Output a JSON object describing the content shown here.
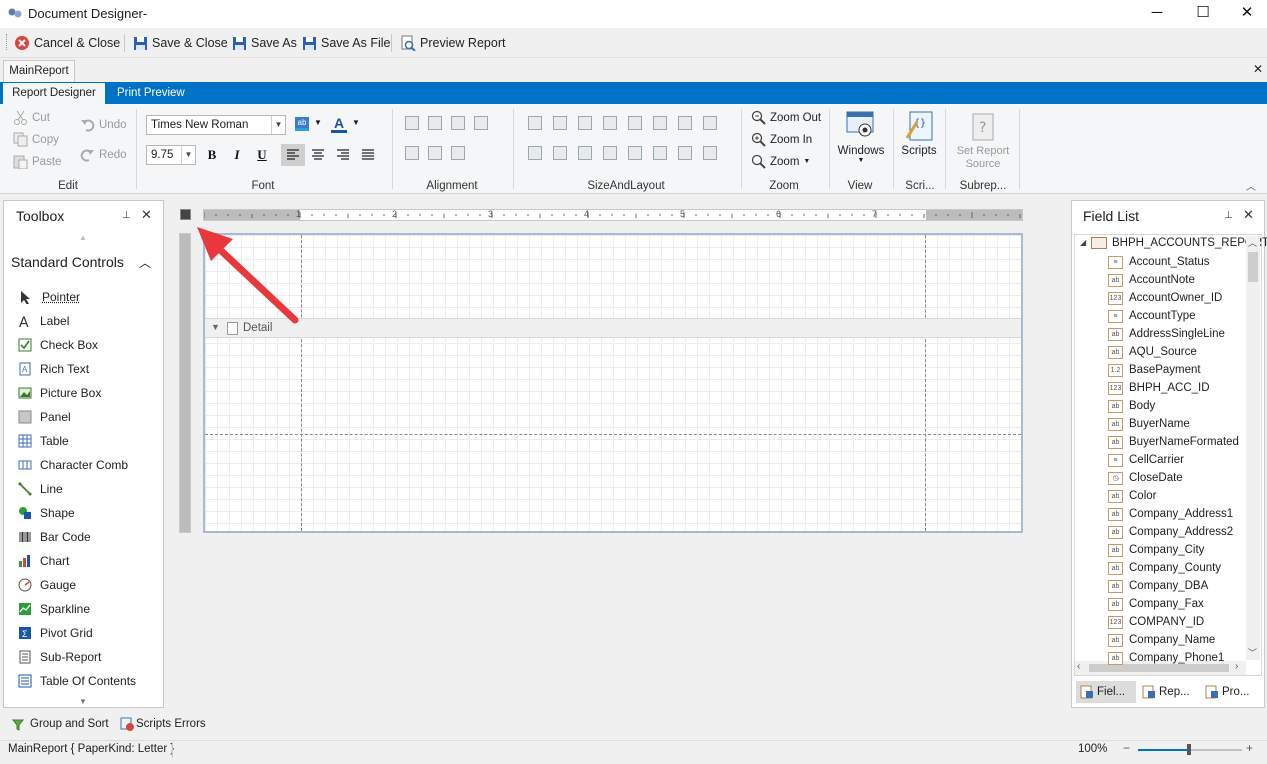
{
  "window": {
    "title": "Document Designer-",
    "minimize": "─",
    "maximize": "☐",
    "close": "✕"
  },
  "toolbar": {
    "cancel_close": "Cancel & Close",
    "save_close": "Save & Close",
    "save_as": "Save As",
    "save_as_file": "Save As File",
    "preview_report": "Preview Report"
  },
  "doc_tab": "MainReport",
  "doc_tab_close": "✕",
  "ribbon_tabs": {
    "designer": "Report Designer",
    "preview": "Print Preview"
  },
  "ribbon": {
    "edit": {
      "cut": "Cut",
      "copy": "Copy",
      "paste": "Paste",
      "undo": "Undo",
      "redo": "Redo",
      "label": "Edit"
    },
    "font": {
      "family": "Times New Roman",
      "size": "9.75",
      "label": "Font",
      "bold": "B",
      "italic": "I",
      "underline": "U"
    },
    "alignment": {
      "label": "Alignment"
    },
    "size_layout": {
      "label": "SizeAndLayout"
    },
    "zoom": {
      "zoom_out": "Zoom Out",
      "zoom_in": "Zoom In",
      "zoom": "Zoom",
      "label": "Zoom"
    },
    "view": {
      "windows": "Windows",
      "label": "View"
    },
    "scripts": {
      "scripts": "Scripts",
      "label": "Scri..."
    },
    "subreport": {
      "set_source_line1": "Set Report",
      "set_source_line2": "Source",
      "label": "Subrep..."
    }
  },
  "toolbox": {
    "title": "Toolbox",
    "section": "Standard Controls",
    "items": [
      "Pointer",
      "Label",
      "Check Box",
      "Rich Text",
      "Picture Box",
      "Panel",
      "Table",
      "Character Comb",
      "Line",
      "Shape",
      "Bar Code",
      "Chart",
      "Gauge",
      "Sparkline",
      "Pivot Grid",
      "Sub-Report",
      "Table Of Contents"
    ],
    "icons": [
      "pointer-icon",
      "label-icon",
      "checkbox-icon",
      "rich-text-icon",
      "picture-box-icon",
      "panel-icon",
      "table-icon",
      "character-comb-icon",
      "line-icon",
      "shape-icon",
      "barcode-icon",
      "chart-icon",
      "gauge-icon",
      "sparkline-icon",
      "pivot-grid-icon",
      "subreport-icon",
      "table-of-contents-icon"
    ]
  },
  "canvas": {
    "band_detail": "Detail",
    "ruler_numbers": [
      "1",
      "2",
      "3",
      "4",
      "5",
      "6",
      "7"
    ]
  },
  "field_list": {
    "title": "Field List",
    "root": "BHPH_ACCOUNTS_REPORT",
    "fields": [
      {
        "name": "Account_Status",
        "type": "list"
      },
      {
        "name": "AccountNote",
        "type": "ab"
      },
      {
        "name": "AccountOwner_ID",
        "type": "123"
      },
      {
        "name": "AccountType",
        "type": "list"
      },
      {
        "name": "AddressSingleLine",
        "type": "ab"
      },
      {
        "name": "AQU_Source",
        "type": "ab"
      },
      {
        "name": "BasePayment",
        "type": "1.2"
      },
      {
        "name": "BHPH_ACC_ID",
        "type": "123"
      },
      {
        "name": "Body",
        "type": "ab"
      },
      {
        "name": "BuyerName",
        "type": "ab"
      },
      {
        "name": "BuyerNameFormated",
        "type": "ab"
      },
      {
        "name": "CellCarrier",
        "type": "list"
      },
      {
        "name": "CloseDate",
        "type": "date"
      },
      {
        "name": "Color",
        "type": "ab"
      },
      {
        "name": "Company_Address1",
        "type": "ab"
      },
      {
        "name": "Company_Address2",
        "type": "ab"
      },
      {
        "name": "Company_City",
        "type": "ab"
      },
      {
        "name": "Company_County",
        "type": "ab"
      },
      {
        "name": "Company_DBA",
        "type": "ab"
      },
      {
        "name": "Company_Fax",
        "type": "ab"
      },
      {
        "name": "COMPANY_ID",
        "type": "123"
      },
      {
        "name": "Company_Name",
        "type": "ab"
      },
      {
        "name": "Company_Phone1",
        "type": "ab"
      }
    ],
    "bottom_tabs": [
      "Fiel...",
      "Rep...",
      "Pro..."
    ]
  },
  "bottom": {
    "group_sort": "Group and Sort",
    "scripts_errors": "Scripts Errors"
  },
  "status": {
    "report_info": "MainReport { PaperKind: Letter }",
    "zoom": "100%",
    "zoom_minus": "−",
    "zoom_plus": "+"
  },
  "colors": {
    "ribbon_blue": "#0072c6",
    "arrow": "#e8383d"
  }
}
